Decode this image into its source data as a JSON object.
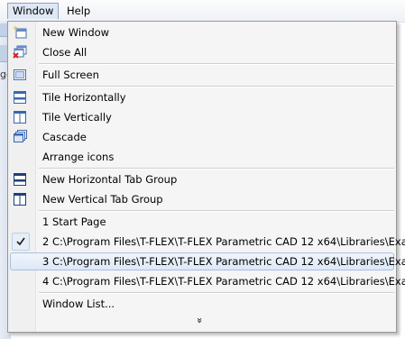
{
  "menubar": {
    "window": "Window",
    "help": "Help"
  },
  "menu": {
    "new_window": "New Window",
    "close_all": "Close All",
    "full_screen": "Full Screen",
    "tile_horizontally": "Tile Horizontally",
    "tile_vertically": "Tile Vertically",
    "cascade": "Cascade",
    "arrange_icons": "Arrange icons",
    "new_horizontal_tab_group": "New Horizontal Tab Group",
    "new_vertical_tab_group": "New Vertical Tab Group",
    "doc1": "1 Start Page",
    "doc2": "2 C:\\Program Files\\T-FLEX\\T-FLEX Parametric CAD 12 x64\\Libraries\\Exa...",
    "doc3": "3 C:\\Program Files\\T-FLEX\\T-FLEX Parametric CAD 12 x64\\Libraries\\Exa...",
    "doc4": "4 C:\\Program Files\\T-FLEX\\T-FLEX Parametric CAD 12 x64\\Libraries\\Exa...",
    "window_list": "Window List...",
    "expand_glyph": "»"
  },
  "background": {
    "strip_text": "ge"
  },
  "colors": {
    "accent": "#a8c0e0",
    "icon_blue": "#3a66b0"
  }
}
